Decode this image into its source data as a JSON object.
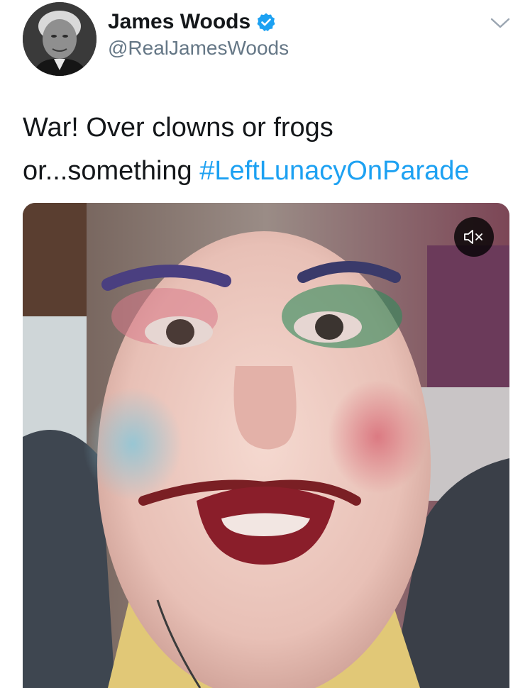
{
  "author": {
    "display_name": "James Woods",
    "handle": "@RealJamesWoods",
    "verified": true
  },
  "tweet": {
    "text_plain": "War! Over clowns or frogs or...something ",
    "hashtag": "#LeftLunacyOnParade"
  },
  "media": {
    "type": "video",
    "muted": true
  },
  "colors": {
    "link": "#1da1f2",
    "secondary_text": "#657786",
    "primary_text": "#14171a",
    "verified_badge": "#1da1f2"
  },
  "icons": {
    "verified": "verified-badge-icon",
    "menu": "chevron-down-icon",
    "mute": "speaker-muted-icon"
  }
}
